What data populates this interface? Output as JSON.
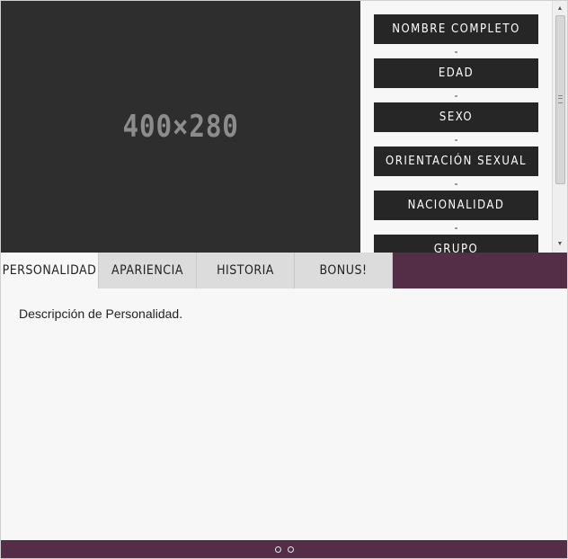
{
  "image": {
    "placeholder_text": "400×280"
  },
  "info_fields": [
    {
      "label": "NOMBRE COMPLETO"
    },
    {
      "label": "EDAD"
    },
    {
      "label": "SEXO"
    },
    {
      "label": "ORIENTACIÓN SEXUAL"
    },
    {
      "label": "NACIONALIDAD"
    },
    {
      "label": "GRUPO"
    }
  ],
  "separator": "-",
  "tabs": [
    {
      "label": "PERSONALIDAD",
      "active": true
    },
    {
      "label": "APARIENCIA",
      "active": false
    },
    {
      "label": "HISTORIA",
      "active": false
    },
    {
      "label": "BONUS!",
      "active": false
    }
  ],
  "content": {
    "text": "Descripción de Personalidad."
  },
  "pager": {
    "dots": 2
  },
  "colors": {
    "accent": "#542d47",
    "field_bg": "#262626",
    "tab_bg": "#dcdcdc",
    "page_bg": "#f7f7f7"
  },
  "icons": {
    "scroll_up": "triangle-up-icon",
    "scroll_down": "triangle-down-icon"
  }
}
